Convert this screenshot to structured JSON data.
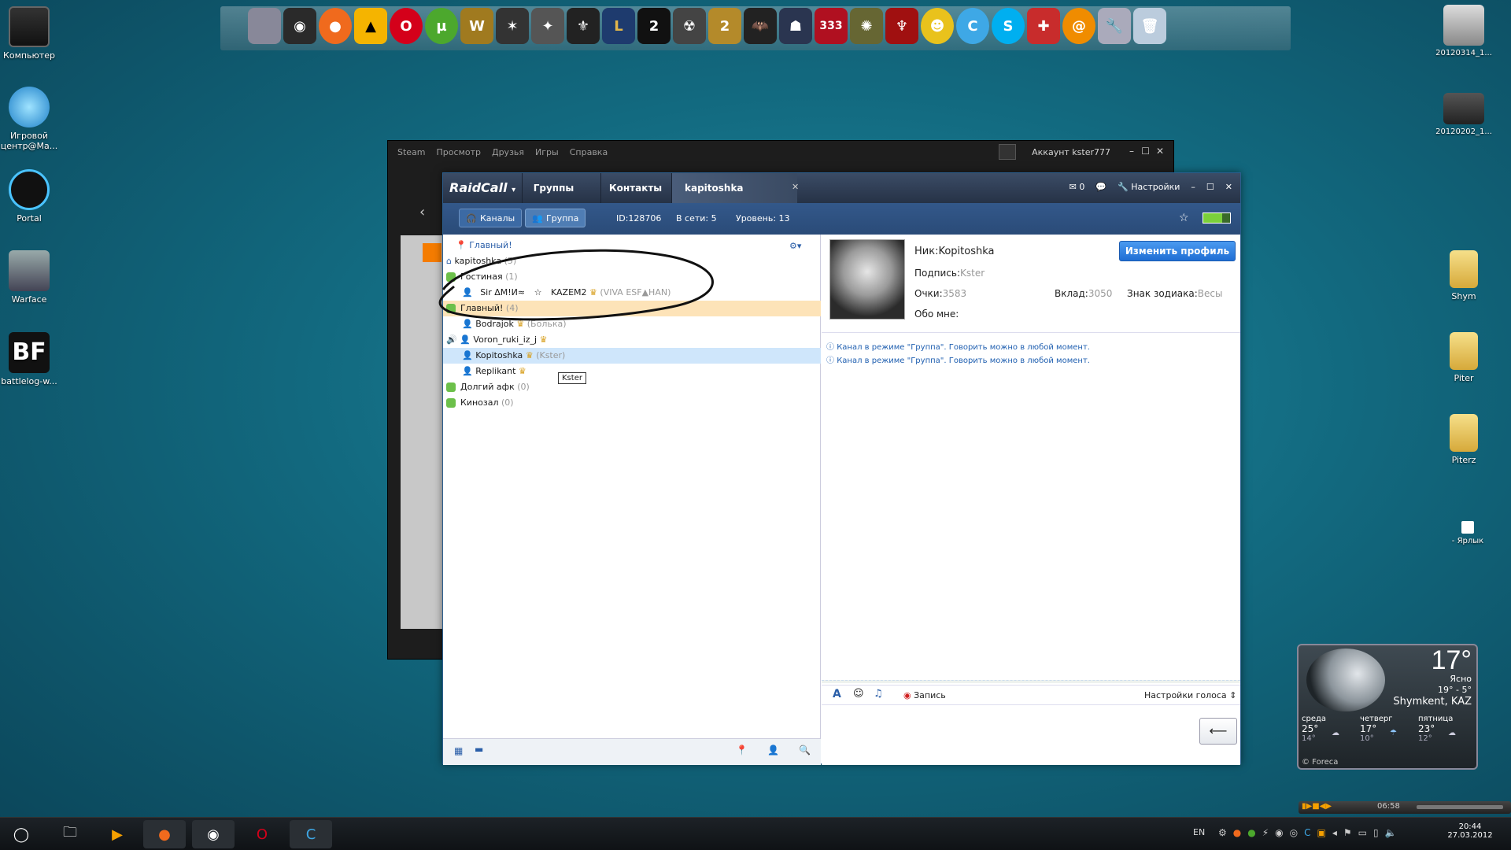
{
  "desktop": {
    "left_icons": [
      {
        "label": "Компьютер"
      },
      {
        "label": "Игровой центр@Ма..."
      },
      {
        "label": "Portal"
      },
      {
        "label": "Warface"
      },
      {
        "label": "battlelog-w..."
      }
    ],
    "right_icons": [
      {
        "label": "20120314_1..."
      },
      {
        "label": "20120202_1..."
      },
      {
        "label": "Shym"
      },
      {
        "label": "Piter"
      },
      {
        "label": "Piterz"
      },
      {
        "label": "- Ярлык"
      }
    ]
  },
  "steam": {
    "menu": [
      "Steam",
      "Просмотр",
      "Друзья",
      "Игры",
      "Справка"
    ],
    "account": "Аккаунт kster777"
  },
  "raidcall": {
    "logo": "RaidCall",
    "tabs": [
      "Группы",
      "Контакты",
      "kapitoshka"
    ],
    "mail_count": "0",
    "settings_label": "Настройки",
    "sub": {
      "channels_btn": "Каналы",
      "group_btn": "Группа",
      "id": "ID:128706",
      "online": "В сети: 5",
      "level": "Уровень: 13"
    },
    "tree": {
      "header": "Главный!",
      "root": "kapitoshka",
      "root_count": "(5)",
      "ch1": "Гостиная",
      "ch1_count": "(1)",
      "user1_name": "Sir ΔM!И≈",
      "user1_extra": "KAZEM2",
      "user1_note": "(VIVA ESF▲HAN)",
      "ch2": "Главный!",
      "ch2_count": "(4)",
      "u2": "Bodrajok",
      "u2_note": "(Болька)",
      "u3": "Voron_ruki_iz_j",
      "u4": "Kopitoshka",
      "u4_note": "(Kster)",
      "u5": "Replikant",
      "tooltip": "Kster",
      "ch3": "Долгий афк",
      "ch3_count": "(0)",
      "ch4": "Кинозал",
      "ch4_count": "(0)"
    },
    "profile": {
      "nick_label": "Ник:",
      "nick": "Kopitoshka",
      "sign_label": "Подпись:",
      "sign": "Kster",
      "points_label": "Очки:",
      "points": "3583",
      "contrib_label": "Вклад:",
      "contrib": "3050",
      "zodiac_label": "Знак зодиака:",
      "zodiac": "Весы",
      "about_label": "Обо мне:",
      "edit_button": "Изменить профиль"
    },
    "messages": [
      "Канал в режиме \"Группа\". Говорить можно в любой момент.",
      "Канал в режиме \"Группа\". Говорить можно в любой момент."
    ],
    "toolbar": {
      "record": "Запись",
      "voice_settings": "Настройки голоса"
    }
  },
  "weather": {
    "temp": "17°",
    "cond": "Ясно",
    "hilo": "19° - 5°",
    "city": "Shymkent, KAZ",
    "days": [
      {
        "name": "среда",
        "hi": "25°",
        "lo": "14°"
      },
      {
        "name": "четверг",
        "hi": "17°",
        "lo": "10°"
      },
      {
        "name": "пятница",
        "hi": "23°",
        "lo": "12°"
      }
    ],
    "credit": "© Foreca"
  },
  "taskbar": {
    "lang": "EN",
    "time": "20:44",
    "date": "27.03.2012",
    "media_time": "06:58"
  }
}
